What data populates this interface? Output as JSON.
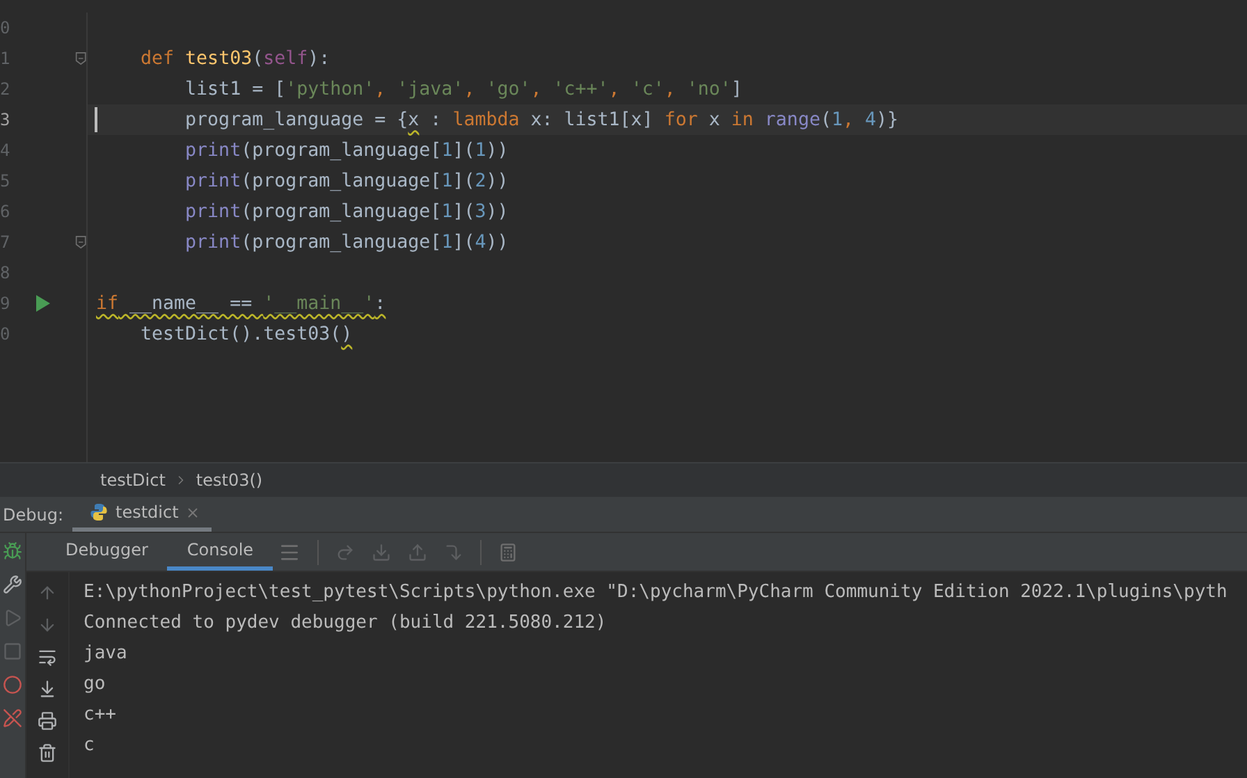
{
  "editor": {
    "lines": [
      {
        "number": "0",
        "fold": false,
        "run": false,
        "current": false
      },
      {
        "number": "1",
        "fold": true,
        "run": false,
        "current": false,
        "tokens": [
          {
            "text": "    def ",
            "kind": "keyword"
          },
          {
            "text": "test03",
            "kind": "func"
          },
          {
            "text": "(",
            "kind": "plain"
          },
          {
            "text": "self",
            "kind": "self"
          },
          {
            "text": "):",
            "kind": "plain"
          }
        ]
      },
      {
        "number": "2",
        "fold": false,
        "run": false,
        "current": false,
        "tokens": [
          {
            "text": "        list1 = [",
            "kind": "plain"
          },
          {
            "text": "'python'",
            "kind": "string"
          },
          {
            "text": ", ",
            "kind": "keyword"
          },
          {
            "text": "'java'",
            "kind": "string"
          },
          {
            "text": ", ",
            "kind": "keyword"
          },
          {
            "text": "'go'",
            "kind": "string"
          },
          {
            "text": ", ",
            "kind": "keyword"
          },
          {
            "text": "'c++'",
            "kind": "string"
          },
          {
            "text": ", ",
            "kind": "keyword"
          },
          {
            "text": "'c'",
            "kind": "string"
          },
          {
            "text": ", ",
            "kind": "keyword"
          },
          {
            "text": "'no'",
            "kind": "string"
          },
          {
            "text": "]",
            "kind": "plain"
          }
        ]
      },
      {
        "number": "3",
        "fold": false,
        "run": false,
        "current": true,
        "tokens": [
          {
            "text": "        program_language = {",
            "kind": "plain"
          },
          {
            "text": "x",
            "kind": "plain",
            "warn": true
          },
          {
            "text": " : ",
            "kind": "plain"
          },
          {
            "text": "lambda",
            "kind": "keyword"
          },
          {
            "text": " x: list1[x] ",
            "kind": "plain"
          },
          {
            "text": "for",
            "kind": "keyword"
          },
          {
            "text": " x ",
            "kind": "plain"
          },
          {
            "text": "in ",
            "kind": "keyword"
          },
          {
            "text": "range",
            "kind": "builtin"
          },
          {
            "text": "(",
            "kind": "plain"
          },
          {
            "text": "1",
            "kind": "number"
          },
          {
            "text": ", ",
            "kind": "keyword"
          },
          {
            "text": "4",
            "kind": "number"
          },
          {
            "text": ")}",
            "kind": "plain"
          }
        ]
      },
      {
        "number": "4",
        "fold": false,
        "run": false,
        "current": false,
        "tokens": [
          {
            "text": "        print",
            "kind": "builtin"
          },
          {
            "text": "(program_language[",
            "kind": "plain"
          },
          {
            "text": "1",
            "kind": "number"
          },
          {
            "text": "](",
            "kind": "plain"
          },
          {
            "text": "1",
            "kind": "number"
          },
          {
            "text": "))",
            "kind": "plain"
          }
        ]
      },
      {
        "number": "5",
        "fold": false,
        "run": false,
        "current": false,
        "tokens": [
          {
            "text": "        print",
            "kind": "builtin"
          },
          {
            "text": "(program_language[",
            "kind": "plain"
          },
          {
            "text": "1",
            "kind": "number"
          },
          {
            "text": "](",
            "kind": "plain"
          },
          {
            "text": "2",
            "kind": "number"
          },
          {
            "text": "))",
            "kind": "plain"
          }
        ]
      },
      {
        "number": "6",
        "fold": false,
        "run": false,
        "current": false,
        "tokens": [
          {
            "text": "        print",
            "kind": "builtin"
          },
          {
            "text": "(program_language[",
            "kind": "plain"
          },
          {
            "text": "1",
            "kind": "number"
          },
          {
            "text": "](",
            "kind": "plain"
          },
          {
            "text": "3",
            "kind": "number"
          },
          {
            "text": "))",
            "kind": "plain"
          }
        ]
      },
      {
        "number": "7",
        "fold": true,
        "run": false,
        "current": false,
        "tokens": [
          {
            "text": "        print",
            "kind": "builtin"
          },
          {
            "text": "(program_language[",
            "kind": "plain"
          },
          {
            "text": "1",
            "kind": "number"
          },
          {
            "text": "](",
            "kind": "plain"
          },
          {
            "text": "4",
            "kind": "number"
          },
          {
            "text": "))",
            "kind": "plain"
          }
        ]
      },
      {
        "number": "8",
        "fold": false,
        "run": false,
        "current": false
      },
      {
        "number": "9",
        "fold": false,
        "run": true,
        "current": false,
        "tokens": [
          {
            "text": "if",
            "kind": "keyword",
            "warn": true
          },
          {
            "text": " __name__ == ",
            "kind": "plain",
            "warn": true
          },
          {
            "text": "'__main__'",
            "kind": "string",
            "warn": true
          },
          {
            "text": ":",
            "kind": "plain",
            "warn": true
          }
        ]
      },
      {
        "number": "0",
        "fold": false,
        "run": false,
        "current": false,
        "tokens": [
          {
            "text": "    testDict().test03(",
            "kind": "plain"
          },
          {
            "text": ")",
            "kind": "plain",
            "warn": true
          }
        ]
      }
    ]
  },
  "breadcrumb": [
    "testDict",
    "test03()"
  ],
  "debug": {
    "label": "Debug:",
    "sessions": [
      {
        "name": "testdict",
        "selected": true
      }
    ],
    "tabs": [
      {
        "label": "Debugger",
        "selected": false
      },
      {
        "label": "Console",
        "selected": true
      }
    ],
    "console": [
      "E:\\pythonProject\\test_pytest\\Scripts\\python.exe \"D:\\pycharm\\PyCharm Community Edition 2022.1\\plugins\\pyth",
      "Connected to pydev debugger (build 221.5080.212)",
      "java",
      "go",
      "c++",
      "c"
    ]
  }
}
